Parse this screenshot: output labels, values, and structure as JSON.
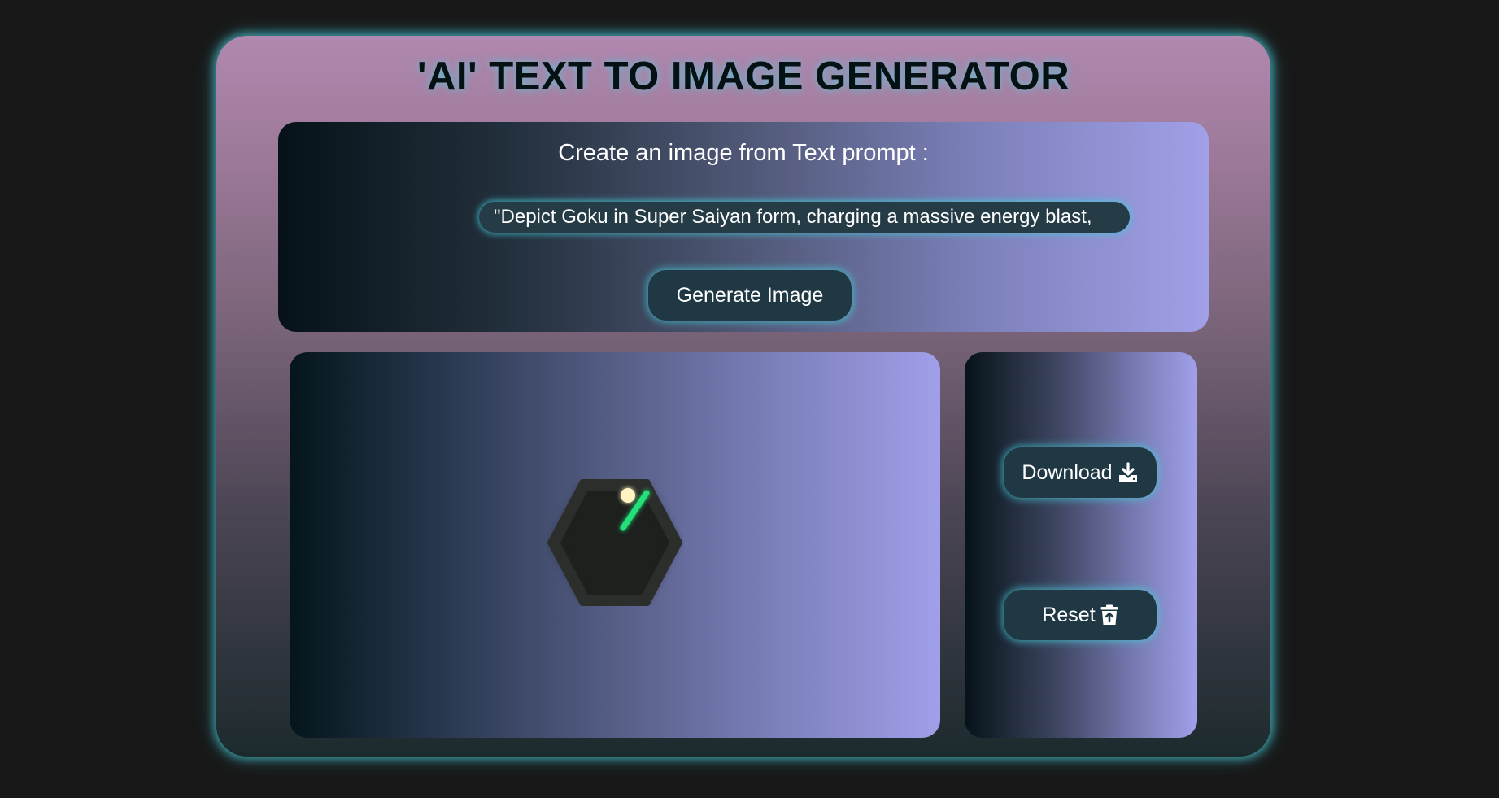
{
  "header": {
    "title": "'AI' TEXT TO IMAGE GENERATOR"
  },
  "prompt": {
    "heading": "Create an image from Text prompt :",
    "input_value": "\"Depict Goku in Super Saiyan form, charging a massive energy blast,",
    "generate_label": "Generate Image"
  },
  "actions": {
    "download_label": "Download",
    "download_icon": "download-icon",
    "reset_label": "Reset",
    "reset_icon": "trash-icon"
  },
  "image_area": {
    "status_icon": "hexagon-loader-icon"
  },
  "colors": {
    "accent_glow": "#48c9d6",
    "button_bg": "#1f3844",
    "page_bg": "#181818",
    "loader_green": "#22e07a"
  }
}
